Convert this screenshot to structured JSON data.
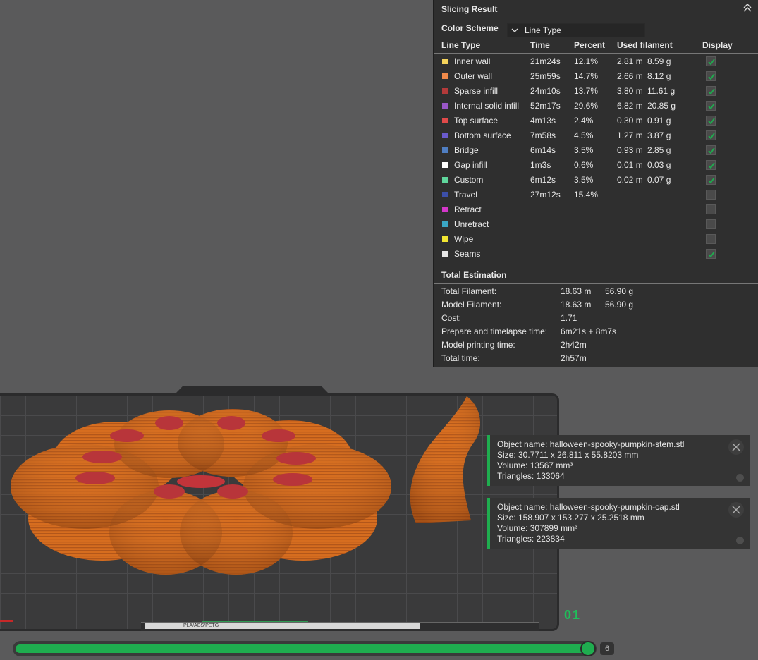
{
  "slicing_result": {
    "title": "Slicing Result",
    "color_scheme_label": "Color Scheme",
    "color_scheme_value": "Line Type",
    "headers": [
      "Line Type",
      "Time",
      "Percent",
      "Used filament",
      "Display"
    ],
    "rows": [
      {
        "name": "Inner wall",
        "color": "#f5d35b",
        "time": "21m24s",
        "percent": "12.1%",
        "length": "2.81 m",
        "weight": "8.59 g",
        "display": true
      },
      {
        "name": "Outer wall",
        "color": "#f08a4a",
        "time": "25m59s",
        "percent": "14.7%",
        "length": "2.66 m",
        "weight": "8.12 g",
        "display": true
      },
      {
        "name": "Sparse infill",
        "color": "#b33a3a",
        "time": "24m10s",
        "percent": "13.7%",
        "length": "3.80 m",
        "weight": "11.61 g",
        "display": true
      },
      {
        "name": "Internal solid infill",
        "color": "#9a57c7",
        "time": "52m17s",
        "percent": "29.6%",
        "length": "6.82 m",
        "weight": "20.85 g",
        "display": true
      },
      {
        "name": "Top surface",
        "color": "#e04a4a",
        "time": "4m13s",
        "percent": "2.4%",
        "length": "0.30 m",
        "weight": "0.91 g",
        "display": true
      },
      {
        "name": "Bottom surface",
        "color": "#6a5acd",
        "time": "7m58s",
        "percent": "4.5%",
        "length": "1.27 m",
        "weight": "3.87 g",
        "display": true
      },
      {
        "name": "Bridge",
        "color": "#4f7ec2",
        "time": "6m14s",
        "percent": "3.5%",
        "length": "0.93 m",
        "weight": "2.85 g",
        "display": true
      },
      {
        "name": "Gap infill",
        "color": "#ffffff",
        "time": "1m3s",
        "percent": "0.6%",
        "length": "0.01 m",
        "weight": "0.03 g",
        "display": true
      },
      {
        "name": "Custom",
        "color": "#5fd69c",
        "time": "6m12s",
        "percent": "3.5%",
        "length": "0.02 m",
        "weight": "0.07 g",
        "display": true
      },
      {
        "name": "Travel",
        "color": "#3c4fa8",
        "time": "27m12s",
        "percent": "15.4%",
        "length": "",
        "weight": "",
        "display": false
      },
      {
        "name": "Retract",
        "color": "#d437c9",
        "time": "",
        "percent": "",
        "length": "",
        "weight": "",
        "display": false
      },
      {
        "name": "Unretract",
        "color": "#3aa6c4",
        "time": "",
        "percent": "",
        "length": "",
        "weight": "",
        "display": false
      },
      {
        "name": "Wipe",
        "color": "#f2e632",
        "time": "",
        "percent": "",
        "length": "",
        "weight": "",
        "display": false
      },
      {
        "name": "Seams",
        "color": "#e6e6e6",
        "time": "",
        "percent": "",
        "length": "",
        "weight": "",
        "display": true
      }
    ],
    "total_title": "Total Estimation",
    "totals": [
      {
        "label": "Total Filament:",
        "value": "18.63 m",
        "value2": "56.90 g"
      },
      {
        "label": "Model Filament:",
        "value": "18.63 m",
        "value2": "56.90 g"
      },
      {
        "label": "Cost:",
        "value": "1.71",
        "value2": ""
      },
      {
        "label": "Prepare and timelapse time:",
        "value": "6m21s + 8m7s",
        "value2": ""
      },
      {
        "label": "Model printing time:",
        "value": "2h42m",
        "value2": ""
      },
      {
        "label": "Total time:",
        "value": "2h57m",
        "value2": ""
      }
    ]
  },
  "objects": [
    {
      "name": "Object name: halloween-spooky-pumpkin-stem.stl",
      "size": "Size: 30.7711 x 26.811 x 55.8203 mm",
      "volume": "Volume: 13567 mm³",
      "triangles": "Triangles: 133064"
    },
    {
      "name": "Object name: halloween-spooky-pumpkin-cap.stl",
      "size": "Size: 158.907 x 153.277 x 25.2518 mm",
      "volume": "Volume: 307899 mm³",
      "triangles": "Triangles: 223834"
    }
  ],
  "plate": {
    "number": "01",
    "bed_label": "PLA/ABS/PETG"
  },
  "layer_slider": {
    "value": "6",
    "progress": 0.99
  },
  "colors": {
    "accent": "#1fad4f",
    "panel_bg": "#2f2f2f",
    "model_orange": "#d46a1e",
    "model_top": "#c23a32"
  }
}
